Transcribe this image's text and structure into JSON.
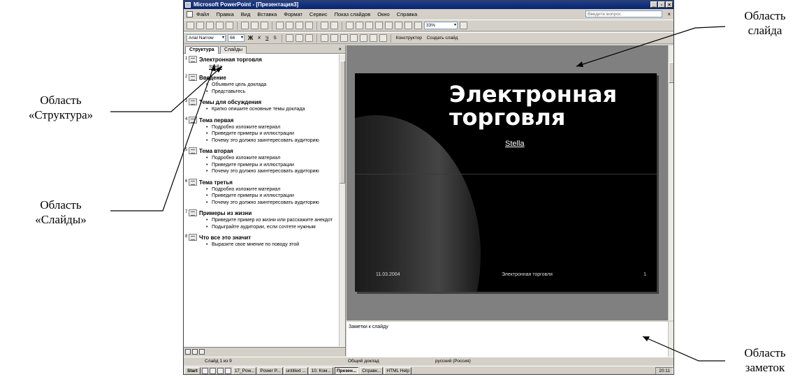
{
  "window": {
    "title": "Microsoft PowerPoint - [Презентация3]",
    "controls": [
      "_",
      "▫",
      "×"
    ]
  },
  "menu": {
    "items": [
      "Файл",
      "Правка",
      "Вид",
      "Вставка",
      "Формат",
      "Сервис",
      "Показ слайдов",
      "Окно",
      "Справка"
    ],
    "ask_placeholder": "Введите вопрос",
    "close": "×"
  },
  "toolbar1": {
    "zoom": "33%"
  },
  "toolbar2": {
    "font": "Arial Narrow",
    "size": "66",
    "bold": "Ж",
    "italic": "К",
    "underline": "Ч",
    "shadow": "S",
    "designer": "Конструктор",
    "new_slide": "Создать слайд"
  },
  "panes": {
    "tab_outline": "Структура",
    "tab_slides": "Слайды",
    "close": "×"
  },
  "outline": [
    {
      "num": "1",
      "title": "Электронная торговля",
      "subtitle": "Stella",
      "bullets": []
    },
    {
      "num": "2",
      "title": "Введение",
      "bullets": [
        "Объявите цель доклада",
        "Представьтесь"
      ]
    },
    {
      "num": "3",
      "title": "Темы для обсуждения",
      "bullets": [
        "Кратко опишите основные темы доклада"
      ]
    },
    {
      "num": "4",
      "title": "Тема первая",
      "bullets": [
        "Подробно изложите материал",
        "Приведите примеры и иллюстрации",
        "Почему это должно заинтересовать аудиторию"
      ]
    },
    {
      "num": "5",
      "title": "Тема вторая",
      "bullets": [
        "Подробно изложите материал",
        "Приведите примеры и иллюстрации",
        "Почему это должно заинтересовать аудиторию"
      ]
    },
    {
      "num": "6",
      "title": "Тема третья",
      "bullets": [
        "Подробно изложите материал",
        "Приведите примеры и иллюстрации",
        "Почему это должно заинтересовать аудиторию"
      ]
    },
    {
      "num": "7",
      "title": "Примеры из жизни",
      "bullets": [
        "Приведите пример из жизни или расскажите анекдот",
        "Подыграйте аудитории, если сочтете нужным"
      ]
    },
    {
      "num": "8",
      "title": "Что все это значит",
      "bullets": [
        "Выразите свое мнение по поводу этой"
      ]
    }
  ],
  "slide": {
    "title": "Электронная торговля",
    "subtitle": "Stella",
    "date": "11.03.2004",
    "footer": "Электронная торговля",
    "number": "1"
  },
  "notes": {
    "placeholder": "Заметки к слайду"
  },
  "status": {
    "slide_of": "Слайд 1 из 9",
    "design": "Общий доклад",
    "lang": "русский (Россия)"
  },
  "taskbar": {
    "start": "Start",
    "tasks": [
      "17_Pow...",
      "Power P...",
      "untitled ...",
      "10. Ком...",
      "Презен...",
      "Справк...",
      "HTML Help"
    ],
    "clock": "20:11"
  },
  "callouts": {
    "structure": [
      "Область",
      "«Структура»"
    ],
    "slides": [
      "Область",
      "«Слайды»"
    ],
    "slide": [
      "Область",
      "слайда"
    ],
    "notes": [
      "Область",
      "заметок"
    ]
  }
}
